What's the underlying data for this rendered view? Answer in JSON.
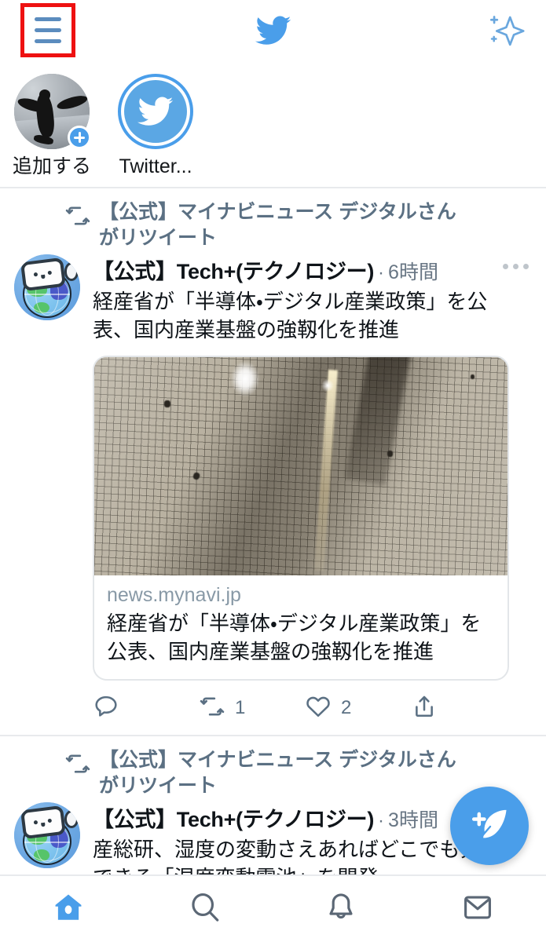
{
  "app": {
    "name": "Twitter",
    "accent_color": "#4a9eea",
    "highlight_color": "#ee1111",
    "text_color": "#0f1419",
    "muted_color": "#5b7083"
  },
  "header": {
    "menu_icon": "hamburger-menu-icon",
    "logo_icon": "twitter-bird-logo",
    "sparkle_icon": "sparkle-icon",
    "menu_highlighted": true
  },
  "fleets": [
    {
      "label": "追加する",
      "avatar": "penguin-photo-avatar",
      "badge": "plus-badge",
      "has_ring": false
    },
    {
      "label": "Twitter...",
      "avatar": "twitter-logo-avatar",
      "badge": "",
      "has_ring": true
    }
  ],
  "tweets": [
    {
      "retweet_label": "【公式】マイナビニュース デジタルさんがリツイート",
      "retweet_icon": "retweet-icon",
      "avatar": "globe-robot-avatar",
      "display_name": "【公式】Tech+(テクノロジー)",
      "time_separator": "·",
      "timestamp": "6時間",
      "more_icon": "more-options-icon",
      "text": "経産省が「半導体・デジタル産業政策」を公表、国内産業基盤の強靱化を推進",
      "card": {
        "image": "semiconductor-wafer-photo",
        "domain": "news.mynavi.jp",
        "title": "経産省が「半導体・デジタル産業政策」を公表、国内産業基盤の強靱化を推進"
      },
      "actions": [
        {
          "icon": "reply-icon",
          "count": ""
        },
        {
          "icon": "retweet-icon",
          "count": "1"
        },
        {
          "icon": "like-icon",
          "count": "2"
        },
        {
          "icon": "share-icon",
          "count": ""
        }
      ]
    },
    {
      "retweet_label": "【公式】マイナビニュース デジタルさんがリツイート",
      "retweet_icon": "retweet-icon",
      "avatar": "globe-robot-avatar",
      "display_name": "【公式】Tech+(テクノロジー)",
      "time_separator": "·",
      "timestamp": "3時間",
      "more_icon": "more-options-icon",
      "text": "産総研、湿度の変動さえあればどこでも発電できる「湿度変動電池」を開発"
    }
  ],
  "compose_button": {
    "icon": "compose-feather-icon"
  },
  "bottom_nav": [
    {
      "icon": "home-icon",
      "active": true
    },
    {
      "icon": "search-icon",
      "active": false
    },
    {
      "icon": "notifications-bell-icon",
      "active": false
    },
    {
      "icon": "messages-envelope-icon",
      "active": false
    }
  ]
}
